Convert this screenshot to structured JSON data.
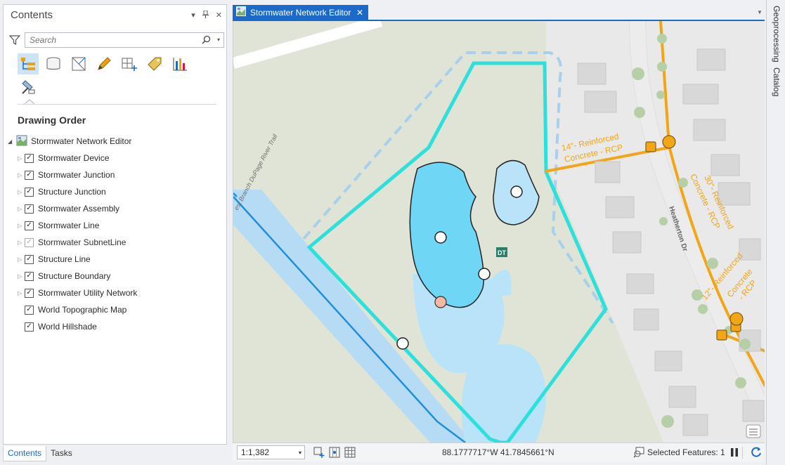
{
  "contents": {
    "title": "Contents",
    "controls": {
      "menu": "▾",
      "pin": "📌",
      "close": "✕"
    },
    "search_placeholder": "Search",
    "drawing_order": "Drawing Order",
    "root_layer": "Stormwater Network Editor",
    "layers": [
      {
        "label": "Stormwater Device",
        "checked": true,
        "expandable": true,
        "dimmed": false
      },
      {
        "label": "Stormwater Junction",
        "checked": true,
        "expandable": true,
        "dimmed": false
      },
      {
        "label": "Structure Junction",
        "checked": true,
        "expandable": true,
        "dimmed": false
      },
      {
        "label": "Stormwater Assembly",
        "checked": true,
        "expandable": true,
        "dimmed": false
      },
      {
        "label": "Stormwater Line",
        "checked": true,
        "expandable": true,
        "dimmed": false
      },
      {
        "label": "Stormwater SubnetLine",
        "checked": true,
        "expandable": true,
        "dimmed": true
      },
      {
        "label": "Structure Line",
        "checked": true,
        "expandable": true,
        "dimmed": false
      },
      {
        "label": "Structure Boundary",
        "checked": true,
        "expandable": true,
        "dimmed": false
      },
      {
        "label": "Stormwater Utility Network",
        "checked": true,
        "expandable": true,
        "dimmed": false
      },
      {
        "label": "World Topographic Map",
        "checked": true,
        "expandable": false,
        "dimmed": false
      },
      {
        "label": "World Hillshade",
        "checked": true,
        "expandable": false,
        "dimmed": false
      }
    ],
    "tabs": {
      "contents": "Contents",
      "tasks": "Tasks"
    }
  },
  "map_tab": {
    "label": "Stormwater Network Editor",
    "close": "✕"
  },
  "map": {
    "labels": {
      "trail": "est Branch DuPage River Trail",
      "street": "Heatherton Dr",
      "pipe14_a": "14\"- Reinforced",
      "pipe14_b": "Concrete - RCP",
      "pipe30_a": "30\"- Reinforced",
      "pipe30_b": "Concrete - RCP",
      "pipe12_a": "12\"- Reinforced",
      "pipe12_b": "Concrete",
      "pipe12_c": "- RCP",
      "badge": "DT"
    },
    "colors": {
      "background": "#dfe4d6",
      "residential": "#e9eaea",
      "water_deep": "#6fd6f5",
      "water_light": "#b9e3f8",
      "boundary": "#2de0dc",
      "pipe": "#f2a516",
      "line": "#1f8ed6"
    }
  },
  "status": {
    "scale": "1:1,382",
    "coordinates": "88.1777717°W 41.7845661°N",
    "selected_features": "Selected Features: 1"
  },
  "side_tabs": {
    "geoprocessing": "Geoprocessing",
    "catalog": "Catalog"
  }
}
